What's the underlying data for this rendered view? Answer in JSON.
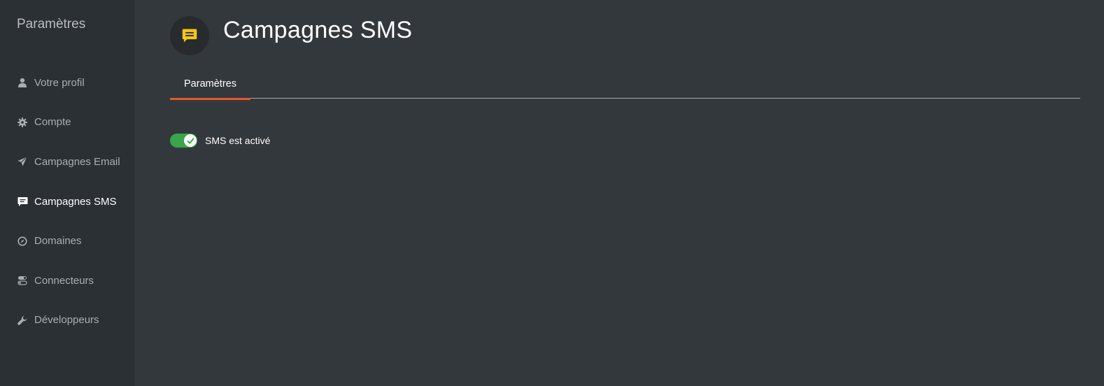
{
  "sidebar": {
    "title": "Paramètres",
    "items": [
      {
        "label": "Votre profil",
        "icon": "user-icon",
        "active": false
      },
      {
        "label": "Compte",
        "icon": "gear-icon",
        "active": false
      },
      {
        "label": "Campagnes Email",
        "icon": "paper-plane-icon",
        "active": false
      },
      {
        "label": "Campagnes SMS",
        "icon": "chat-bubble-icon",
        "active": true
      },
      {
        "label": "Domaines",
        "icon": "compass-icon",
        "active": false
      },
      {
        "label": "Connecteurs",
        "icon": "toggles-icon",
        "active": false
      },
      {
        "label": "Développeurs",
        "icon": "wrench-icon",
        "active": false
      }
    ]
  },
  "header": {
    "title": "Campagnes SMS",
    "icon": "chat-bubble-icon",
    "icon_color": "#f5c518"
  },
  "tabs": [
    {
      "label": "Paramètres",
      "active": true
    }
  ],
  "settings": {
    "sms_toggle": {
      "label": "SMS est activé",
      "enabled": true
    }
  },
  "colors": {
    "accent": "#e8572c",
    "toggle_on": "#3aa54a",
    "sidebar_bg": "#2b3034",
    "main_bg": "#33383c"
  }
}
